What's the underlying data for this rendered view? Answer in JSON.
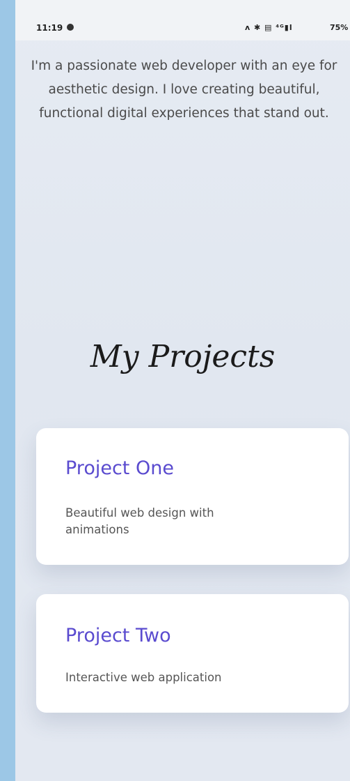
{
  "status_bar": {
    "time": "11:19",
    "icons_text": "ᴧ ✱ ▤ ⁴ᴳ▮l",
    "battery": "75%"
  },
  "intro": {
    "text": "I'm a passionate web developer with an eye for aesthetic design. I love creating beautiful, functional digital experiences that stand out."
  },
  "projects": {
    "title": "My Projects",
    "items": [
      {
        "title": "Project One",
        "description": "Beautiful web design with animations"
      },
      {
        "title": "Project Two",
        "description": "Interactive web application"
      }
    ]
  },
  "colors": {
    "accent": "#5a4bcf",
    "outer_background": "#9cc7e6",
    "page_background": "#e3e8f1",
    "card_background": "#ffffff"
  }
}
